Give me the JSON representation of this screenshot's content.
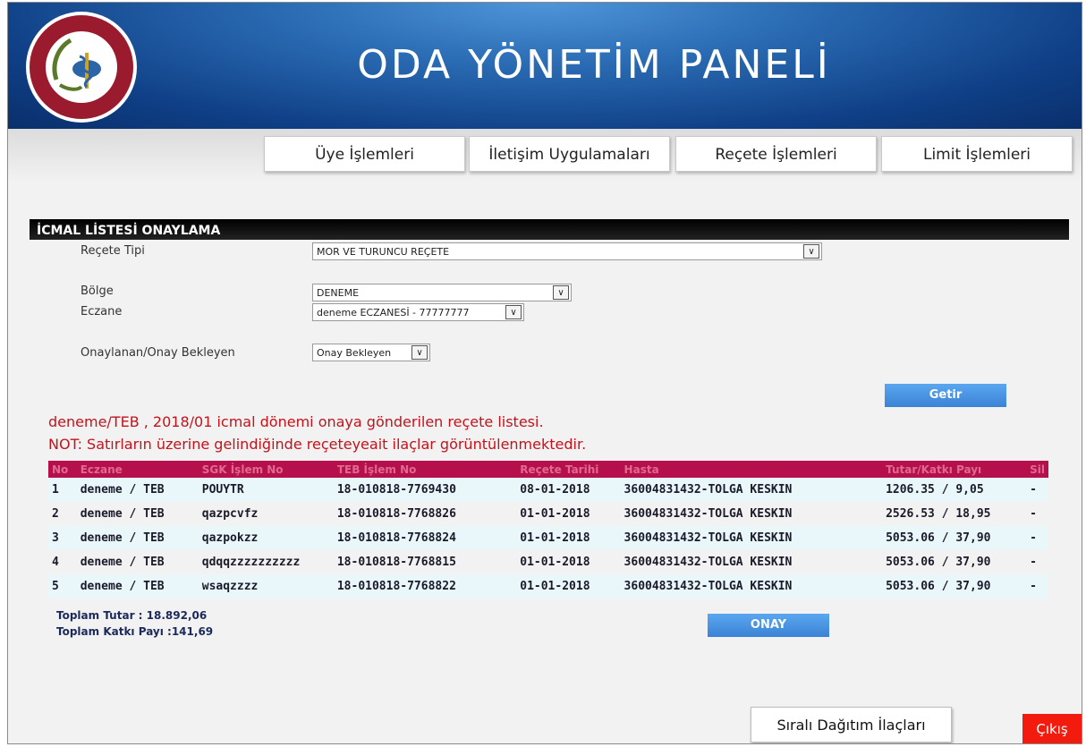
{
  "header": {
    "title": "ODA YÖNETİM PANELİ",
    "logo_icon": "pharmacist-association-logo"
  },
  "menu": [
    {
      "label": "Üye İşlemleri"
    },
    {
      "label": "İletişim Uygulamaları"
    },
    {
      "label": "Reçete İşlemleri"
    },
    {
      "label": "Limit İşlemleri"
    }
  ],
  "section": {
    "title": "İCMAL LİSTESİ ONAYLAMA"
  },
  "filters": {
    "recete_tipi": {
      "label": "Reçete Tipi",
      "value": "MOR VE TURUNCU REÇETE"
    },
    "bolge": {
      "label": "Bölge",
      "value": "DENEME"
    },
    "eczane": {
      "label": "Eczane",
      "value": "deneme ECZANESİ - 77777777"
    },
    "onay": {
      "label": "Onaylanan/Onay Bekleyen",
      "value": "Onay Bekleyen"
    },
    "fetch_label": "Getir"
  },
  "notice": {
    "line1": "deneme/TEB , 2018/01 icmal dönemi onaya gönderilen reçete listesi.",
    "line2": "NOT: Satırların üzerine gelindiğinde reçeteyeait ilaçlar görüntülenmektedir."
  },
  "table": {
    "headers": [
      "No",
      "Eczane",
      "SGK İşlem No",
      "TEB İşlem No",
      "Reçete Tarihi",
      "Hasta",
      "Tutar/Katkı Payı",
      "Sil"
    ],
    "rows": [
      [
        "1",
        "deneme / TEB",
        "POUYTR",
        "18-010818-7769430",
        "08-01-2018",
        "36004831432-TOLGA KESKIN",
        "1206.35 / 9,05",
        "-"
      ],
      [
        "2",
        "deneme / TEB",
        "qazpcvfz",
        "18-010818-7768826",
        "01-01-2018",
        "36004831432-TOLGA KESKIN",
        "2526.53 / 18,95",
        "-"
      ],
      [
        "3",
        "deneme / TEB",
        "qazpokzz",
        "18-010818-7768824",
        "01-01-2018",
        "36004831432-TOLGA KESKIN",
        "5053.06 / 37,90",
        "-"
      ],
      [
        "4",
        "deneme / TEB",
        "qdqqzzzzzzzzzz",
        "18-010818-7768815",
        "01-01-2018",
        "36004831432-TOLGA KESKIN",
        "5053.06 / 37,90",
        "-"
      ],
      [
        "5",
        "deneme / TEB",
        "wsaqzzzz",
        "18-010818-7768822",
        "01-01-2018",
        "36004831432-TOLGA KESKIN",
        "5053.06 / 37,90",
        "-"
      ]
    ]
  },
  "totals": {
    "tutar": "Toplam Tutar : 18.892,06",
    "katki": "Toplam Katkı Payı :141,69"
  },
  "approve_label": "ONAY",
  "footer": {
    "distribution_label": "Sıralı Dağıtım İlaçları",
    "exit_label": "Çıkış"
  },
  "colors": {
    "header_blue": "#0f3f86",
    "table_header": "#b5104c",
    "notice_red": "#c4121b",
    "exit_red": "#f21b0e"
  }
}
